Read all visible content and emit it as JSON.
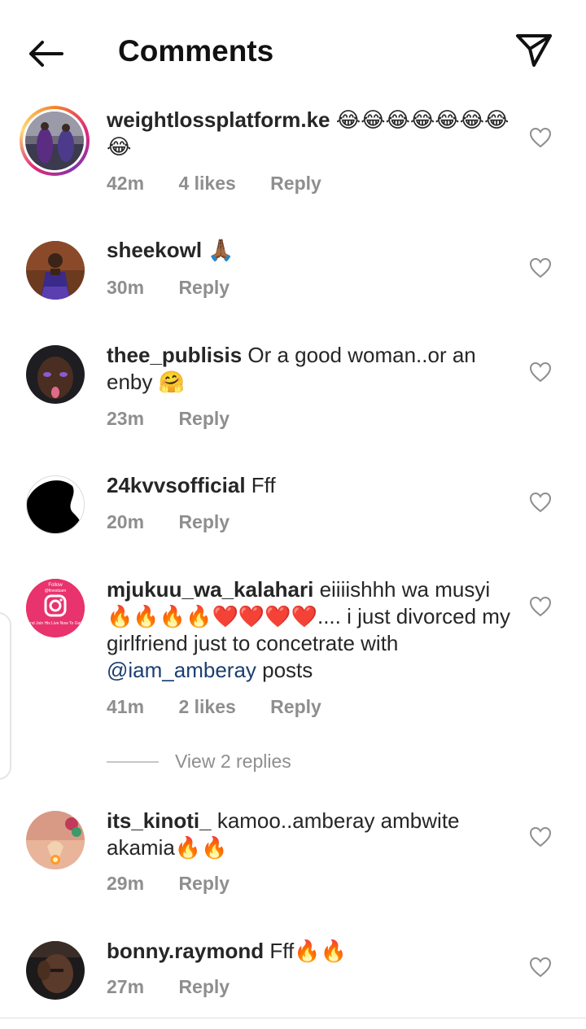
{
  "header": {
    "title": "Comments",
    "back_icon": "arrow-left-icon",
    "send_icon": "paper-plane-icon"
  },
  "comments": [
    {
      "username": "weightlossplatform.ke",
      "text": "😂😂😂😂😂😂😂😂",
      "time": "42m",
      "likes": "4 likes",
      "reply": "Reply"
    },
    {
      "username": "sheekowl",
      "text": "🙏🏾",
      "time": "30m",
      "reply": "Reply"
    },
    {
      "username": "thee_publisis",
      "text": " Or a good woman..or an enby 🤗",
      "time": "23m",
      "reply": "Reply"
    },
    {
      "username": "24kvvsofficial",
      "text": " Fff",
      "time": "20m",
      "reply": "Reply"
    },
    {
      "username": "mjukuu_wa_kalahari",
      "text_before": " eiiiishhh wa musyi 🔥🔥🔥🔥❤️❤️❤️❤️.... i just divorced my girlfriend just to concetrate with ",
      "mention": "@iam_amberay",
      "text_after": " posts",
      "time": "41m",
      "likes": "2 likes",
      "reply": "Reply",
      "view_replies": "View 2 replies",
      "avatar_text_top": "Follow",
      "avatar_handle": "@finestsam",
      "avatar_text_bottom": "And Join His Live Now To Gain"
    },
    {
      "username": "its_kinoti_",
      "text": " kamoo..amberay ambwite akamia🔥🔥",
      "time": "29m",
      "reply": "Reply"
    },
    {
      "username": "bonny.raymond",
      "text": " Fff🔥🔥",
      "time": "27m",
      "reply": "Reply"
    }
  ],
  "colors": {
    "text": "#262626",
    "meta": "#8e8e8e",
    "mention": "#1b3f70",
    "instagram_pink": "#e1306c"
  }
}
